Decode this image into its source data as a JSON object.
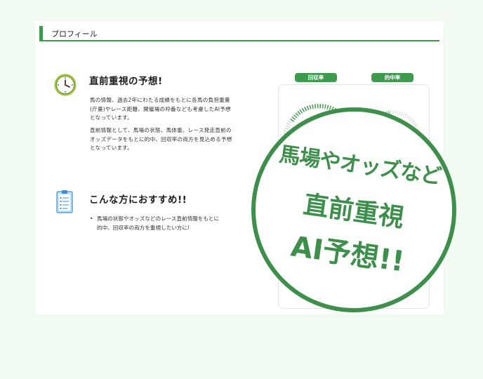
{
  "profile": {
    "title": "プロフィール"
  },
  "section1": {
    "heading": "直前重視の予想!",
    "para1_lines": [
      "馬の情報、過去2年にわたる成績をもとに各馬の負担重量",
      "(斤量)やレース距離、開催場の枠番なども考慮したAI予想",
      "となっています。"
    ],
    "para2_lines": [
      "直前情報として、馬場の状態、馬体重、レース発走直前の",
      "オッズデータをもとに的中、回収率の両方を見込める予想",
      "となっています。"
    ]
  },
  "section2": {
    "heading": "こんな方におすすめ!!",
    "bullet_lines": [
      "馬場の状態やオッズなどのレース直前情報をもとに",
      "的中、回収率の両方を重視したい方に!"
    ]
  },
  "gauges": {
    "return_rate_label": "回収率",
    "hit_rate_label": "的中率"
  },
  "stamp": {
    "line1": "馬場やオッズなど",
    "line2": "直前重視",
    "line3": "AI予想!!"
  },
  "colors": {
    "accent": "#3e9a4e",
    "background": "#f2fcf2"
  },
  "icons": {
    "clock": "clock-icon",
    "clipboard": "clipboard-icon"
  }
}
